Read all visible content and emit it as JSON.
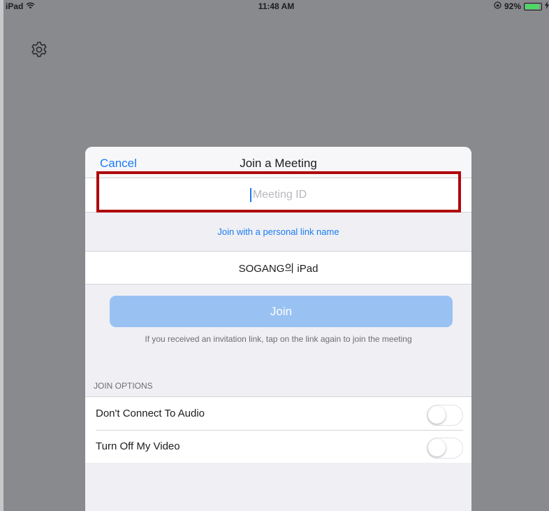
{
  "status_bar": {
    "device": "iPad",
    "time": "11:48 AM",
    "battery": "92%",
    "battery_level": 0.92,
    "icons": [
      "wifi-icon",
      "rotation-lock-icon",
      "battery-icon",
      "charging-icon"
    ]
  },
  "settings": {
    "icon": "gear-icon"
  },
  "dialog": {
    "cancel_label": "Cancel",
    "title": "Join a Meeting",
    "meeting_id_placeholder": "Meeting ID",
    "meeting_id_value": "",
    "personal_link_label": "Join with a personal link name",
    "display_name_value": "SOGANG의 iPad",
    "join_label": "Join",
    "hint": "If you received an invitation link, tap on the link again to join the meeting",
    "options_header": "JOIN OPTIONS",
    "options": [
      {
        "label": "Don't Connect To Audio",
        "enabled": false
      },
      {
        "label": "Turn Off My Video",
        "enabled": false
      }
    ]
  },
  "colors": {
    "accent": "#1a7bf2",
    "join_button_disabled": "#99c2f3",
    "highlight": "#b0090e",
    "backdrop": "#898a8e"
  }
}
